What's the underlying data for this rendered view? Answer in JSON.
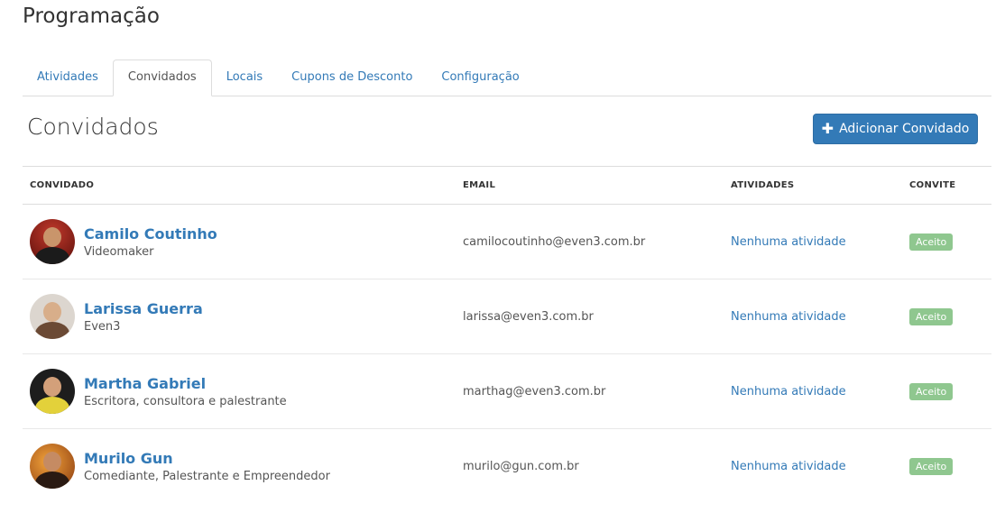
{
  "page": {
    "title": "Programação"
  },
  "tabs": [
    {
      "label": "Atividades",
      "active": false
    },
    {
      "label": "Convidados",
      "active": true
    },
    {
      "label": "Locais",
      "active": false
    },
    {
      "label": "Cupons de Desconto",
      "active": false
    },
    {
      "label": "Configuração",
      "active": false
    }
  ],
  "section": {
    "title": "Convidados",
    "add_button_label": "Adicionar Convidado"
  },
  "table": {
    "headers": [
      "CONVIDADO",
      "EMAIL",
      "ATIVIDADES",
      "CONVITE"
    ],
    "rows": [
      {
        "name": "Camilo Coutinho",
        "role": "Videomaker",
        "email": "camilocoutinho@even3.com.br",
        "activities": "Nenhuma atividade",
        "status": "Aceito"
      },
      {
        "name": "Larissa Guerra",
        "role": "Even3",
        "email": "larissa@even3.com.br",
        "activities": "Nenhuma atividade",
        "status": "Aceito"
      },
      {
        "name": "Martha Gabriel",
        "role": "Escritora, consultora e palestrante",
        "email": "marthag@even3.com.br",
        "activities": "Nenhuma atividade",
        "status": "Aceito"
      },
      {
        "name": "Murilo Gun",
        "role": "Comediante, Palestrante e Empreendedor",
        "email": "murilo@gun.com.br",
        "activities": "Nenhuma atividade",
        "status": "Aceito"
      }
    ]
  },
  "colors": {
    "link": "#337ab7",
    "primary_button": "#337ab7",
    "badge_accepted": "#8fc78f"
  }
}
